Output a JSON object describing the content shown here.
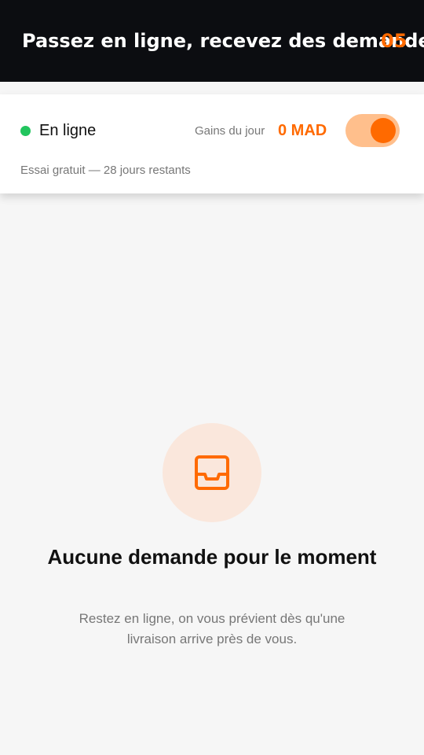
{
  "banner": {
    "marquee_text": "Passez en ligne, recevez des demandes",
    "counter": "05"
  },
  "status_card": {
    "online_label": "En ligne",
    "earnings_label": "Gains du jour",
    "earnings_value": "0 MAD",
    "toggle_on": true,
    "trial_text": "Essai gratuit — 28 jours restants"
  },
  "empty_state": {
    "icon": "inbox-icon",
    "title": "Aucune demande pour le moment",
    "description": "Restez en ligne, on vous prévient dès qu'une livraison arrive près de vous."
  },
  "colors": {
    "accent": "#ff6a00",
    "online": "#22c55e",
    "dark": "#0c0d11"
  }
}
